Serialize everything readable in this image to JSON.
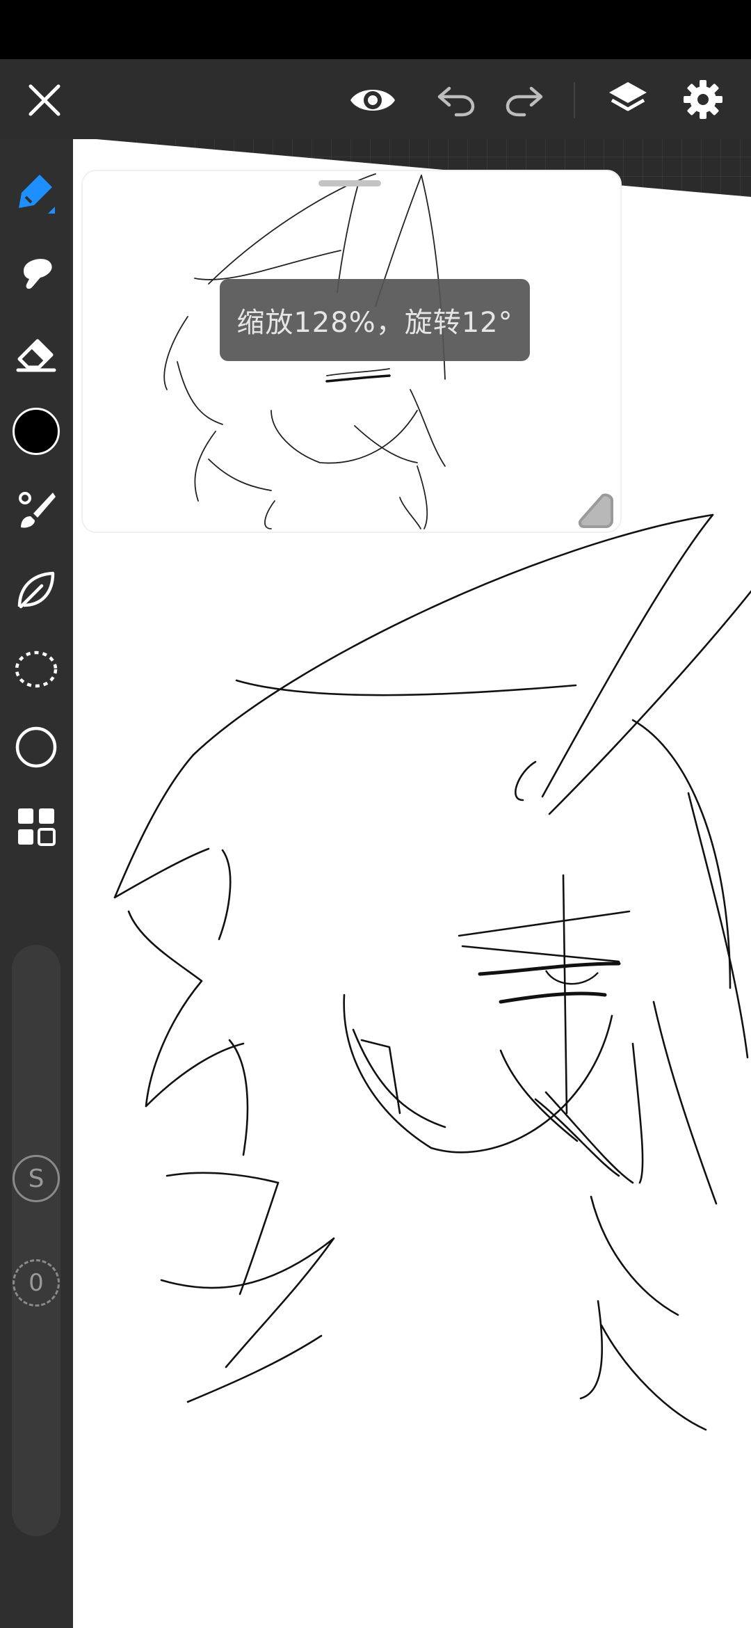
{
  "toolbar": {
    "close_icon": "close-icon",
    "eye_icon": "eye-icon",
    "undo_icon": "undo-icon",
    "redo_icon": "redo-icon",
    "layers_icon": "layers-icon",
    "settings_icon": "gear-icon"
  },
  "sidebar": {
    "tools": [
      {
        "name": "pen",
        "icon": "pen-icon",
        "active": true
      },
      {
        "name": "smudge",
        "icon": "smudge-icon"
      },
      {
        "name": "eraser",
        "icon": "eraser-icon"
      },
      {
        "name": "color",
        "icon": "color-swatch",
        "color": "#000000"
      },
      {
        "name": "brush-library",
        "icon": "brush-icon"
      },
      {
        "name": "fill",
        "icon": "leaf-icon"
      },
      {
        "name": "selection",
        "icon": "lasso-icon"
      },
      {
        "name": "shape",
        "icon": "circle-icon"
      },
      {
        "name": "more",
        "icon": "grid-icon"
      }
    ],
    "size_label": "S",
    "opacity_label": "0"
  },
  "toast": {
    "text": "缩放128%，旋转12°"
  },
  "colors": {
    "accent": "#1e8fff",
    "toolbar_bg": "#2d2d2d",
    "canvas": "#ffffff"
  }
}
